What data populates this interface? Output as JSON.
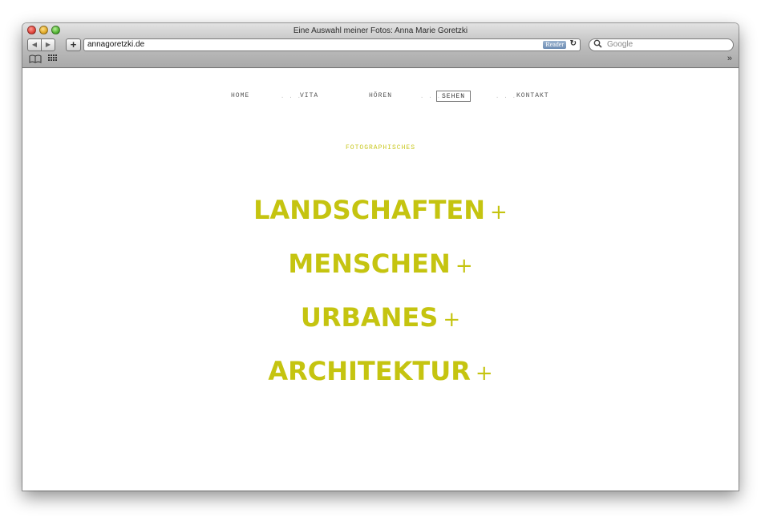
{
  "window": {
    "title": "Eine Auswahl meiner Fotos: Anna Marie Goretzki"
  },
  "toolbar": {
    "back_icon": "◀",
    "forward_icon": "▶",
    "add_icon": "+",
    "url": "annagoretzki.de",
    "reader_label": "Reader",
    "reload_icon": "↻",
    "search_icon": "🔍",
    "search_placeholder": "Google"
  },
  "bookmarks": {
    "book_icon": "📖",
    "grid_icon": "▦",
    "more_icon": "»"
  },
  "nav": {
    "items": [
      {
        "label": "HOME"
      },
      {
        "label": "VITA"
      },
      {
        "label": "HÖREN"
      },
      {
        "label": "SEHEN",
        "active": true
      },
      {
        "label": "KONTAKT"
      }
    ],
    "separator": ". . ."
  },
  "content": {
    "section_label": "FOTOGRAPHISCHES",
    "categories": [
      {
        "label": "LANDSCHAFTEN",
        "plus": "+"
      },
      {
        "label": "MENSCHEN",
        "plus": "+"
      },
      {
        "label": "URBANES",
        "plus": "+"
      },
      {
        "label": "ARCHITEKTUR",
        "plus": "+"
      }
    ]
  },
  "colors": {
    "accent": "#c5c410"
  }
}
